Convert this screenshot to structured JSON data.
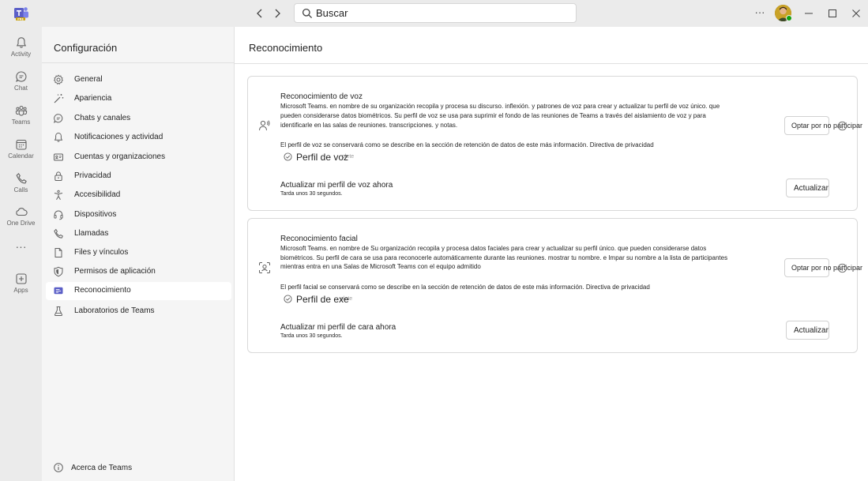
{
  "titlebar": {
    "search_placeholder": "Buscar",
    "more_label": "···"
  },
  "rail": {
    "items": [
      {
        "label": "Activity",
        "icon": "bell-icon"
      },
      {
        "label": "Chat",
        "icon": "chat-icon"
      },
      {
        "label": "Teams",
        "icon": "teams-icon"
      },
      {
        "label": "Calendar",
        "icon": "calendar-icon"
      },
      {
        "label": "Calls",
        "icon": "phone-icon"
      },
      {
        "label": "One Drive",
        "icon": "cloud-icon"
      },
      {
        "label": "Apps",
        "icon": "add-app-icon"
      }
    ],
    "more_label": "···"
  },
  "settings": {
    "title": "Configuración",
    "items": [
      {
        "label": "General",
        "icon": "gear-icon"
      },
      {
        "label": "Apariencia",
        "icon": "magic-wand-icon"
      },
      {
        "label": "Chats y canales",
        "icon": "chat-icon"
      },
      {
        "label": "Notificaciones y actividad",
        "icon": "bell-icon"
      },
      {
        "label": "Cuentas y organizaciones",
        "icon": "id-card-icon"
      },
      {
        "label": "Privacidad",
        "icon": "lock-icon"
      },
      {
        "label": "Accesibilidad",
        "icon": "accessibility-icon"
      },
      {
        "label": "Dispositivos",
        "icon": "headset-icon"
      },
      {
        "label": "Llamadas",
        "icon": "phone-icon"
      },
      {
        "label": "Files y vínculos",
        "icon": "document-icon"
      },
      {
        "label": "Permisos de aplicación",
        "icon": "shield-icon"
      },
      {
        "label": "Reconocimiento",
        "icon": "recognition-icon",
        "active": true
      },
      {
        "label": "Laboratorios de Teams",
        "icon": "beaker-icon"
      }
    ],
    "about_label": "Acerca de Teams"
  },
  "main": {
    "title": "Reconocimiento",
    "voice": {
      "title": "Reconocimiento de voz",
      "desc1": "Microsoft Teams. en nombre de su organización recopila y procesa su discurso. inflexión. y patrones de voz para crear y actualizar tu perfil de voz único. que",
      "desc2": "pueden considerarse datos biométricos. Su perfil de voz se usa para suprimir el fondo de las reuniones de Teams a través del aislamiento de voz y para",
      "desc3": "identificarle en las salas de reuniones. transcripciones. y notas.",
      "note": "El perfil de voz se conservará como se describe en la sección de retención de datos de este más información. Directiva de privacidad",
      "pill_main": "Perfil de voz",
      "pill_ghost": "plete",
      "opt_out": "Optar por no participar",
      "update_title": "Actualizar mi perfil de voz ahora",
      "update_note": "Tarda unos 30 segundos.",
      "update_button": "Actualizar"
    },
    "face": {
      "title": "Reconocimiento facial",
      "desc1": "Microsoft Teams. en nombre de Su organización recopila y procesa datos faciales para crear y actualizar su perfil único. que pueden considerarse datos",
      "desc2": "biométricos. Su perfil de cara se usa para reconocerle automáticamente durante las reuniones. mostrar tu nombre. e Impar su nombre a la lista de participantes",
      "desc3": "mientras entra en una Salas de Microsoft Teams con el equipo admitido",
      "note": "El perfil facial se conservará como se describe en la sección de retención de datos de este más información. Directiva de privacidad",
      "pill_main": "Perfil de exe",
      "pill_ghost": "plete",
      "opt_out": "Optar por no participar",
      "update_title": "Actualizar mi perfil de cara ahora",
      "update_note": "Tarda unos 30 segundos.",
      "update_button": "Actualizar"
    }
  }
}
